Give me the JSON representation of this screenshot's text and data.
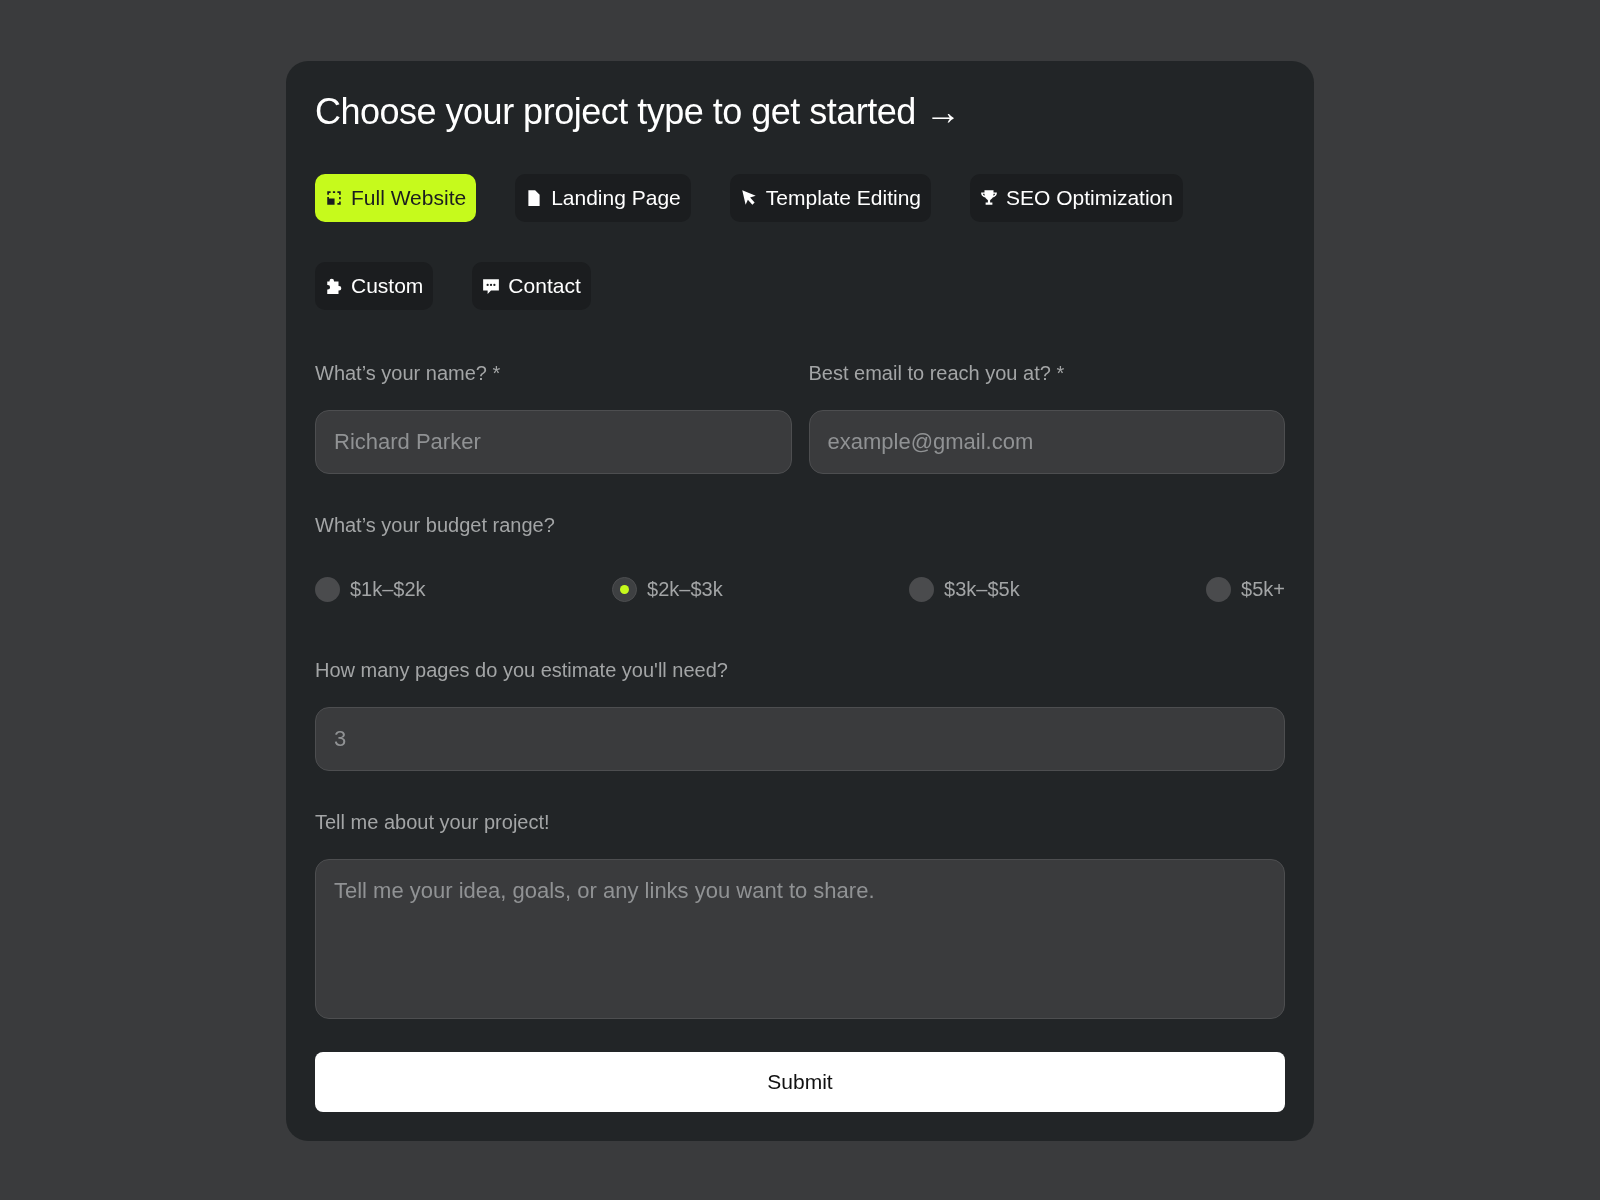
{
  "title": "Choose your project type to get started →",
  "tabs": [
    {
      "label": "Full Website",
      "selected": true
    },
    {
      "label": "Landing Page",
      "selected": false
    },
    {
      "label": "Template Editing",
      "selected": false
    },
    {
      "label": "SEO Optimization",
      "selected": false
    },
    {
      "label": "Custom",
      "selected": false
    },
    {
      "label": "Contact",
      "selected": false
    }
  ],
  "name_field": {
    "label": "What’s your name? *",
    "placeholder": "Richard Parker"
  },
  "email_field": {
    "label": "Best email to reach you at? *",
    "placeholder": "example@gmail.com"
  },
  "budget": {
    "label": "What’s your budget range?",
    "options": [
      {
        "label": "$1k–$2k",
        "selected": false
      },
      {
        "label": "$2k–$3k",
        "selected": true
      },
      {
        "label": "$3k–$5k",
        "selected": false
      },
      {
        "label": "$5k+",
        "selected": false
      }
    ]
  },
  "pages_field": {
    "label": "How many pages do you estimate you'll need?",
    "placeholder": "3"
  },
  "project_field": {
    "label": "Tell me about your project!",
    "placeholder": "Tell me your idea, goals, or any links you want to share."
  },
  "submit": "Submit"
}
